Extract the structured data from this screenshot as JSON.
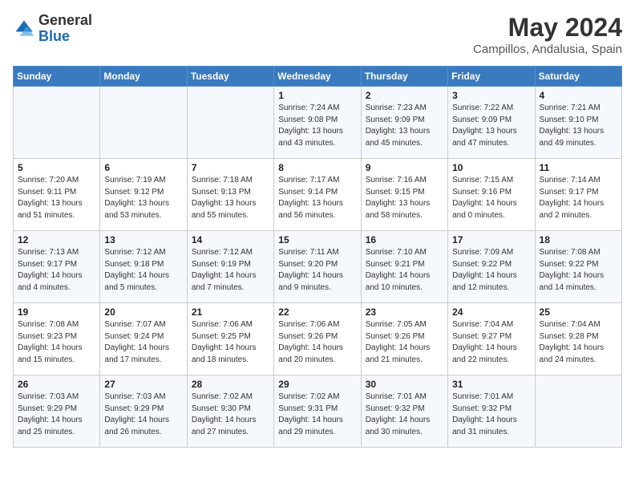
{
  "header": {
    "logo_line1": "General",
    "logo_line2": "Blue",
    "month": "May 2024",
    "location": "Campillos, Andalusia, Spain"
  },
  "weekdays": [
    "Sunday",
    "Monday",
    "Tuesday",
    "Wednesday",
    "Thursday",
    "Friday",
    "Saturday"
  ],
  "weeks": [
    [
      {
        "day": "",
        "info": ""
      },
      {
        "day": "",
        "info": ""
      },
      {
        "day": "",
        "info": ""
      },
      {
        "day": "1",
        "info": "Sunrise: 7:24 AM\nSunset: 9:08 PM\nDaylight: 13 hours\nand 43 minutes."
      },
      {
        "day": "2",
        "info": "Sunrise: 7:23 AM\nSunset: 9:09 PM\nDaylight: 13 hours\nand 45 minutes."
      },
      {
        "day": "3",
        "info": "Sunrise: 7:22 AM\nSunset: 9:09 PM\nDaylight: 13 hours\nand 47 minutes."
      },
      {
        "day": "4",
        "info": "Sunrise: 7:21 AM\nSunset: 9:10 PM\nDaylight: 13 hours\nand 49 minutes."
      }
    ],
    [
      {
        "day": "5",
        "info": "Sunrise: 7:20 AM\nSunset: 9:11 PM\nDaylight: 13 hours\nand 51 minutes."
      },
      {
        "day": "6",
        "info": "Sunrise: 7:19 AM\nSunset: 9:12 PM\nDaylight: 13 hours\nand 53 minutes."
      },
      {
        "day": "7",
        "info": "Sunrise: 7:18 AM\nSunset: 9:13 PM\nDaylight: 13 hours\nand 55 minutes."
      },
      {
        "day": "8",
        "info": "Sunrise: 7:17 AM\nSunset: 9:14 PM\nDaylight: 13 hours\nand 56 minutes."
      },
      {
        "day": "9",
        "info": "Sunrise: 7:16 AM\nSunset: 9:15 PM\nDaylight: 13 hours\nand 58 minutes."
      },
      {
        "day": "10",
        "info": "Sunrise: 7:15 AM\nSunset: 9:16 PM\nDaylight: 14 hours\nand 0 minutes."
      },
      {
        "day": "11",
        "info": "Sunrise: 7:14 AM\nSunset: 9:17 PM\nDaylight: 14 hours\nand 2 minutes."
      }
    ],
    [
      {
        "day": "12",
        "info": "Sunrise: 7:13 AM\nSunset: 9:17 PM\nDaylight: 14 hours\nand 4 minutes."
      },
      {
        "day": "13",
        "info": "Sunrise: 7:12 AM\nSunset: 9:18 PM\nDaylight: 14 hours\nand 5 minutes."
      },
      {
        "day": "14",
        "info": "Sunrise: 7:12 AM\nSunset: 9:19 PM\nDaylight: 14 hours\nand 7 minutes."
      },
      {
        "day": "15",
        "info": "Sunrise: 7:11 AM\nSunset: 9:20 PM\nDaylight: 14 hours\nand 9 minutes."
      },
      {
        "day": "16",
        "info": "Sunrise: 7:10 AM\nSunset: 9:21 PM\nDaylight: 14 hours\nand 10 minutes."
      },
      {
        "day": "17",
        "info": "Sunrise: 7:09 AM\nSunset: 9:22 PM\nDaylight: 14 hours\nand 12 minutes."
      },
      {
        "day": "18",
        "info": "Sunrise: 7:08 AM\nSunset: 9:22 PM\nDaylight: 14 hours\nand 14 minutes."
      }
    ],
    [
      {
        "day": "19",
        "info": "Sunrise: 7:08 AM\nSunset: 9:23 PM\nDaylight: 14 hours\nand 15 minutes."
      },
      {
        "day": "20",
        "info": "Sunrise: 7:07 AM\nSunset: 9:24 PM\nDaylight: 14 hours\nand 17 minutes."
      },
      {
        "day": "21",
        "info": "Sunrise: 7:06 AM\nSunset: 9:25 PM\nDaylight: 14 hours\nand 18 minutes."
      },
      {
        "day": "22",
        "info": "Sunrise: 7:06 AM\nSunset: 9:26 PM\nDaylight: 14 hours\nand 20 minutes."
      },
      {
        "day": "23",
        "info": "Sunrise: 7:05 AM\nSunset: 9:26 PM\nDaylight: 14 hours\nand 21 minutes."
      },
      {
        "day": "24",
        "info": "Sunrise: 7:04 AM\nSunset: 9:27 PM\nDaylight: 14 hours\nand 22 minutes."
      },
      {
        "day": "25",
        "info": "Sunrise: 7:04 AM\nSunset: 9:28 PM\nDaylight: 14 hours\nand 24 minutes."
      }
    ],
    [
      {
        "day": "26",
        "info": "Sunrise: 7:03 AM\nSunset: 9:29 PM\nDaylight: 14 hours\nand 25 minutes."
      },
      {
        "day": "27",
        "info": "Sunrise: 7:03 AM\nSunset: 9:29 PM\nDaylight: 14 hours\nand 26 minutes."
      },
      {
        "day": "28",
        "info": "Sunrise: 7:02 AM\nSunset: 9:30 PM\nDaylight: 14 hours\nand 27 minutes."
      },
      {
        "day": "29",
        "info": "Sunrise: 7:02 AM\nSunset: 9:31 PM\nDaylight: 14 hours\nand 29 minutes."
      },
      {
        "day": "30",
        "info": "Sunrise: 7:01 AM\nSunset: 9:32 PM\nDaylight: 14 hours\nand 30 minutes."
      },
      {
        "day": "31",
        "info": "Sunrise: 7:01 AM\nSunset: 9:32 PM\nDaylight: 14 hours\nand 31 minutes."
      },
      {
        "day": "",
        "info": ""
      }
    ]
  ]
}
